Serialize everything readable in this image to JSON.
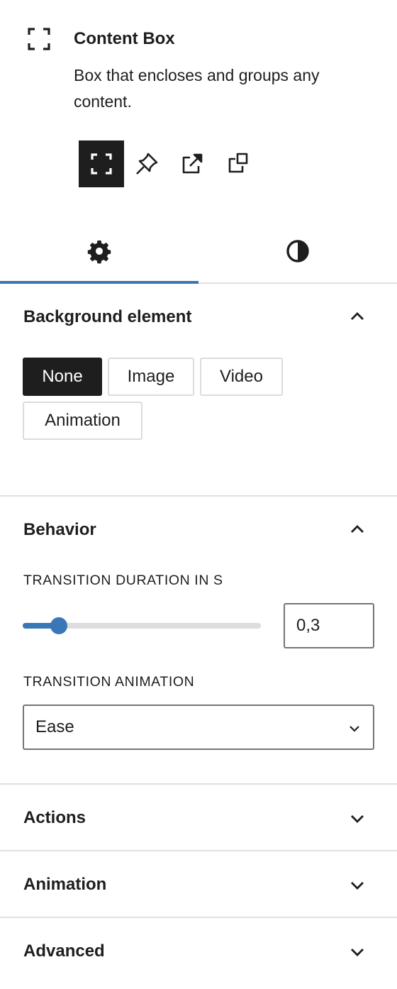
{
  "block": {
    "icon": "content-box-icon",
    "title": "Content Box",
    "description": "Box that encloses and groups any content."
  },
  "variations": [
    {
      "icon": "content-box-icon",
      "active": true
    },
    {
      "icon": "pin-icon",
      "active": false
    },
    {
      "icon": "external-link-icon",
      "active": false
    },
    {
      "icon": "copy-icon",
      "active": false
    }
  ],
  "tabs": [
    {
      "icon": "gear-icon",
      "active": true
    },
    {
      "icon": "contrast-icon",
      "active": false
    }
  ],
  "accent_color": "#3a77b6",
  "background_panel": {
    "title": "Background element",
    "expanded": true,
    "options": [
      "None",
      "Image",
      "Video",
      "Animation"
    ],
    "selected": "None"
  },
  "behavior_panel": {
    "title": "Behavior",
    "expanded": true,
    "duration_label": "TRANSITION DURATION IN S",
    "duration_value": "0,3",
    "duration_fraction": 0.15,
    "animation_label": "TRANSITION ANIMATION",
    "animation_value": "Ease"
  },
  "collapsed_panels": [
    {
      "title": "Actions"
    },
    {
      "title": "Animation"
    },
    {
      "title": "Advanced"
    }
  ]
}
